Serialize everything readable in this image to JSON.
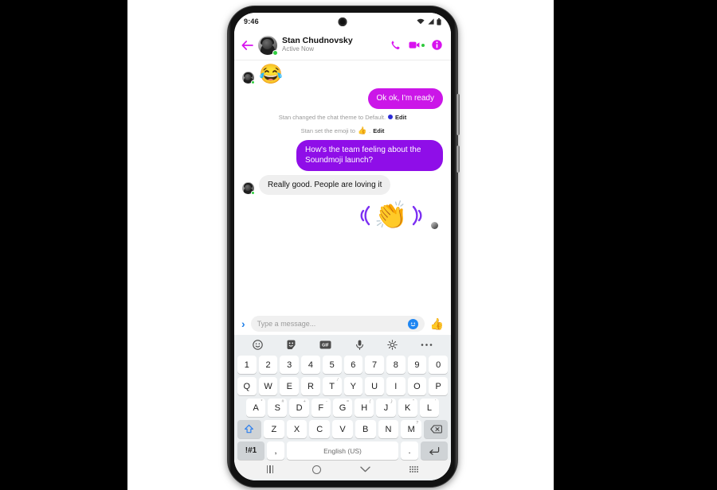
{
  "statusbar": {
    "time": "9:46",
    "icons": [
      "wifi-icon",
      "cellular-signal-icon",
      "battery-icon"
    ]
  },
  "header": {
    "back_icon": "back-arrow-icon",
    "name": "Stan Chudnovsky",
    "status": "Active Now",
    "presence": "online",
    "actions": [
      "call-icon",
      "video-call-icon",
      "info-icon"
    ],
    "accent_color": "#d813ef"
  },
  "conversation": {
    "messages": [
      {
        "type": "emoji",
        "from": "in",
        "emoji": "😂"
      },
      {
        "type": "text",
        "from": "out",
        "text": "Ok ok, I'm ready",
        "color": "#cb16e8"
      },
      {
        "type": "system",
        "text_before": "Stan changed the chat theme to Default.",
        "dot": "#2b2bd6",
        "edit_label": "Edit"
      },
      {
        "type": "system",
        "text_before": "Stan set the emoji to",
        "emoji": "👍",
        "text_after": ".",
        "edit_label": "Edit"
      },
      {
        "type": "text",
        "from": "out",
        "text": "How's the team feeling about the Soundmoji launch?",
        "color": "#8f0ee8"
      },
      {
        "type": "text",
        "from": "in",
        "text": "Really good. People are loving it"
      },
      {
        "type": "soundmoji",
        "from": "out",
        "emoji": "👏",
        "wave_color": "#7b2ff2"
      }
    ]
  },
  "composer": {
    "expand_icon": "chevron-right-icon",
    "placeholder": "Type a message...",
    "value": "",
    "emoji_icon": "emoji-smiley-icon",
    "thumbs_icon": "thumbs-up-icon",
    "accent_color": "#1f86f2"
  },
  "keyboard": {
    "toolbar": [
      "emoji-icon",
      "sticker-icon",
      "gif-icon",
      "microphone-icon",
      "settings-gear-icon",
      "more-options-icon"
    ],
    "row_numbers": [
      "1",
      "2",
      "3",
      "4",
      "5",
      "6",
      "7",
      "8",
      "9",
      "0"
    ],
    "row_qwerty": [
      {
        "key": "Q",
        "sup": ""
      },
      {
        "key": "W",
        "sup": ""
      },
      {
        "key": "E",
        "sup": ""
      },
      {
        "key": "R",
        "sup": ""
      },
      {
        "key": "T",
        "sup": "/"
      },
      {
        "key": "Y",
        "sup": ""
      },
      {
        "key": "U",
        "sup": ""
      },
      {
        "key": "I",
        "sup": ""
      },
      {
        "key": "O",
        "sup": ""
      },
      {
        "key": "P",
        "sup": ""
      }
    ],
    "row_asdf": [
      {
        "key": "A",
        "sup": "*"
      },
      {
        "key": "S",
        "sup": "#"
      },
      {
        "key": "D",
        "sup": "+"
      },
      {
        "key": "F",
        "sup": "-"
      },
      {
        "key": "G",
        "sup": "="
      },
      {
        "key": "H",
        "sup": "("
      },
      {
        "key": "J",
        "sup": ")"
      },
      {
        "key": "K",
        "sup": "\""
      },
      {
        "key": "L",
        "sup": "'"
      }
    ],
    "row_zxcv": [
      {
        "key": "Z",
        "sup": ""
      },
      {
        "key": "X",
        "sup": ""
      },
      {
        "key": "C",
        "sup": ""
      },
      {
        "key": "V",
        "sup": ""
      },
      {
        "key": "B",
        "sup": ""
      },
      {
        "key": "N",
        "sup": ""
      },
      {
        "key": "M",
        "sup": "?"
      }
    ],
    "shift_icon": "shift-key-icon",
    "backspace_icon": "backspace-key-icon",
    "symbols_key": "!#1",
    "comma_key": ",",
    "space_label": "English (US)",
    "period_key": ".",
    "enter_icon": "enter-key-icon"
  },
  "navbar": {
    "items": [
      "recents-icon",
      "home-icon",
      "hide-keyboard-icon",
      "switch-keyboard-icon"
    ]
  }
}
